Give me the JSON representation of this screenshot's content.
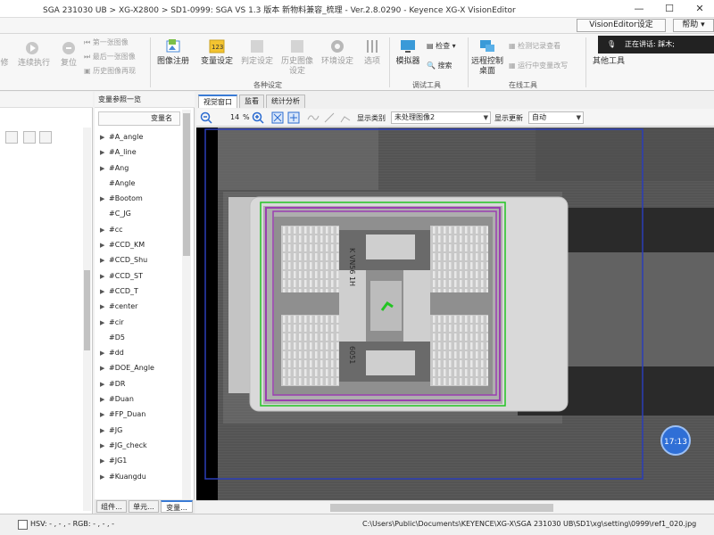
{
  "window": {
    "title": "SGA 231030 UB > XG-X2800 > SD1-0999: SGA VS 1.3 版本 新物料兼容_梳理 - Ver.2.8.0290 - Keyence XG-X VisionEditor",
    "minimize": "—",
    "maximize": "☐",
    "close": "✕"
  },
  "menubar": {
    "visioneditor_settings": "VisionEditor设定",
    "help": "帮助 ▾"
  },
  "ribbon": {
    "partial_left": "修",
    "continuous_run": "连续执行",
    "reset": "复位",
    "first_image": "第一张图像",
    "last_image": "最后一张图像",
    "history_replay": "历史图像再现",
    "image_register": "图像注册",
    "variable_settings": "变量设定",
    "judgment_settings": "判定设定",
    "history_settings": "历史图像设定",
    "env_settings": "环境设定",
    "options": "选项",
    "group_settings": "各种设定",
    "simulator": "模拟器",
    "inspect": "检查 ▾",
    "search": "搜索",
    "group_debug": "调试工具",
    "remote_desktop": "远程控制桌面",
    "log_view": "检测记录查看",
    "runtime_variable": "运行中变量改写",
    "group_online": "在线工具",
    "other_tools": "其他工具",
    "notify": "正在讲话: 踩木;"
  },
  "varpane": {
    "header": "变量参照一览",
    "column": "变量名",
    "items": [
      {
        "label": "#A_angle",
        "expand": true
      },
      {
        "label": "#A_line",
        "expand": true
      },
      {
        "label": "#Ang",
        "expand": true
      },
      {
        "label": "#Angle",
        "expand": false
      },
      {
        "label": "#Bootom",
        "expand": true
      },
      {
        "label": "#C_JG",
        "expand": false
      },
      {
        "label": "#cc",
        "expand": true
      },
      {
        "label": "#CCD_KM",
        "expand": true
      },
      {
        "label": "#CCD_Shu",
        "expand": true
      },
      {
        "label": "#CCD_ST",
        "expand": true
      },
      {
        "label": "#CCD_T",
        "expand": true
      },
      {
        "label": "#center",
        "expand": true
      },
      {
        "label": "#cir",
        "expand": true
      },
      {
        "label": "#D5",
        "expand": false
      },
      {
        "label": "#dd",
        "expand": true
      },
      {
        "label": "#DOE_Angle",
        "expand": true
      },
      {
        "label": "#DR",
        "expand": true
      },
      {
        "label": "#Duan",
        "expand": true
      },
      {
        "label": "#FP_Duan",
        "expand": true
      },
      {
        "label": "#JG",
        "expand": true
      },
      {
        "label": "#JG_check",
        "expand": true
      },
      {
        "label": "#JG1",
        "expand": true
      },
      {
        "label": "#Kuangdu",
        "expand": true
      }
    ],
    "tabs": [
      "组件...",
      "单元...",
      "变量..."
    ]
  },
  "viewer": {
    "tabs": [
      "视觉窗口",
      "监看",
      "统计分析"
    ],
    "zoom": "14",
    "zoom_unit": "%",
    "display_type_label": "显示类别",
    "display_type_value": "未处理图像2",
    "display_update_label": "显示更新",
    "display_update_value": "自动",
    "image_text_1": "K VN56 1H",
    "image_text_2": "6051",
    "time_badge": "17:13"
  },
  "status": {
    "hsv": "HSV: - , - , -   RGB: - , - , -",
    "path": "C:\\Users\\Public\\Documents\\KEYENCE\\XG-X\\SGA 231030 UB\\SD1\\xg\\setting\\0999\\ref1_020.jpg"
  },
  "colors": {
    "accent": "#3a7bd5",
    "inspection_green": "#22c422",
    "inspection_purple": "#9a3fb0",
    "frame_blue": "#2a3db8"
  }
}
